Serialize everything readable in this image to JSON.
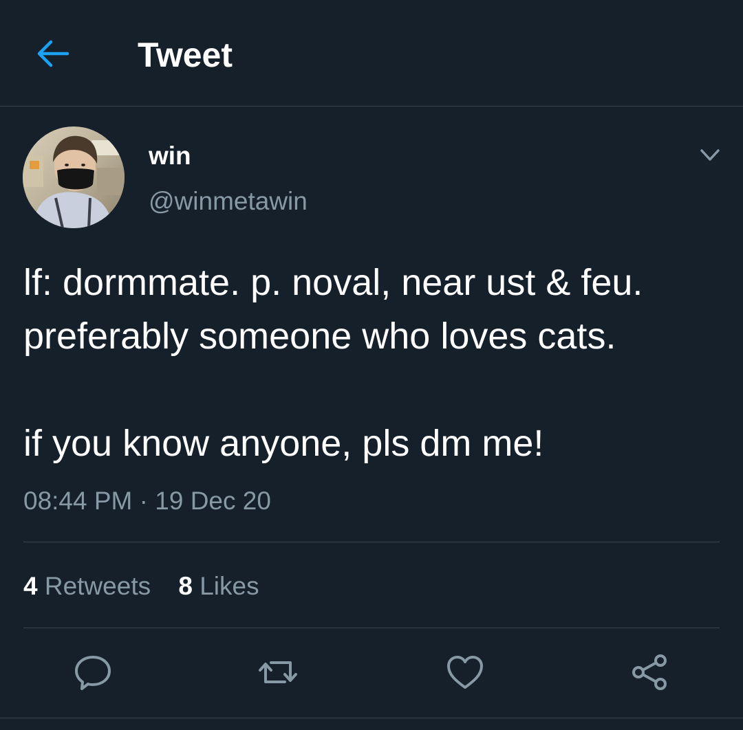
{
  "header": {
    "title": "Tweet",
    "back_icon": "arrow-left-icon"
  },
  "tweet": {
    "author": {
      "display_name": "win",
      "handle": "@winmetawin"
    },
    "text_lines": [
      "lf: dormmate. p. noval, near ust & feu.",
      "preferably someone who loves cats.",
      "",
      "if you know anyone, pls dm me!"
    ],
    "time": "08:44 PM",
    "separator": " · ",
    "date": "19 Dec 20"
  },
  "stats": {
    "retweets_count": "4",
    "retweets_label": "Retweets",
    "likes_count": "8",
    "likes_label": "Likes"
  },
  "actions": {
    "reply_icon": "reply-icon",
    "retweet_icon": "retweet-icon",
    "like_icon": "heart-icon",
    "share_icon": "share-icon"
  },
  "colors": {
    "background": "#15202b",
    "accent": "#1da1f2",
    "secondary_text": "#8899a6",
    "divider": "#38444d"
  }
}
